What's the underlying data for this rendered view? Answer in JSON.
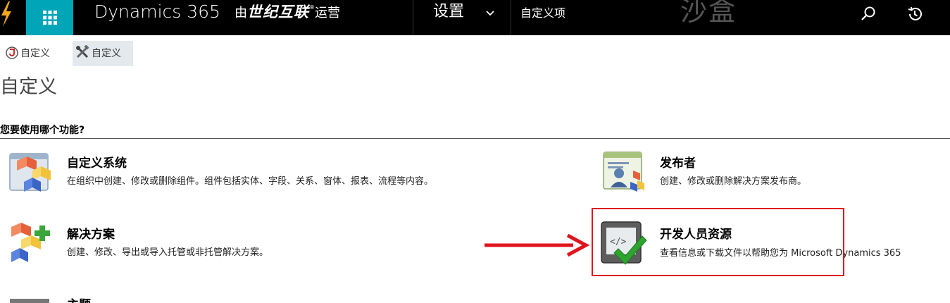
{
  "topbar": {
    "brand": "Dynamics 365",
    "operator_prefix": "由",
    "operator_name": "世纪互联",
    "operator_reg": "®",
    "operator_suffix": "运营",
    "nav_area": "设置",
    "nav_breadcrumb": "自定义项",
    "sandbox_label": "沙盒",
    "icons": [
      "bolt-icon",
      "app-grid-icon",
      "chevron-down-icon",
      "search-icon",
      "recent-history-icon"
    ]
  },
  "commandbar": {
    "items": [
      {
        "label": "自定义",
        "icon": "dynamics-logo-icon"
      },
      {
        "label": "自定义",
        "icon": "tools-icon"
      }
    ]
  },
  "page": {
    "title": "自定义",
    "question": "您要使用哪个功能?"
  },
  "options": [
    {
      "title": "自定义系统",
      "desc": "在组织中创建、修改或删除组件。组件包括实体、字段、关系、窗体、报表、流程等内容。",
      "icon": "customize-system-icon"
    },
    {
      "title": "发布者",
      "desc": "创建、修改或删除解决方案发布商。",
      "icon": "publisher-icon"
    },
    {
      "title": "解决方案",
      "desc": "创建、修改、导出或导入托管或非托管解决方案。",
      "icon": "solutions-icon"
    },
    {
      "title": "开发人员资源",
      "desc": "查看信息或下载文件以帮助您为 Microsoft Dynamics 365",
      "icon": "developer-resources-icon"
    },
    {
      "title": "主题",
      "desc": "",
      "icon": "themes-icon"
    }
  ],
  "colors": {
    "topbar": "#000000",
    "app_tile": "#00a5b8",
    "highlight": "#e0141e",
    "commandbar_selected": "#e4e9ed"
  }
}
